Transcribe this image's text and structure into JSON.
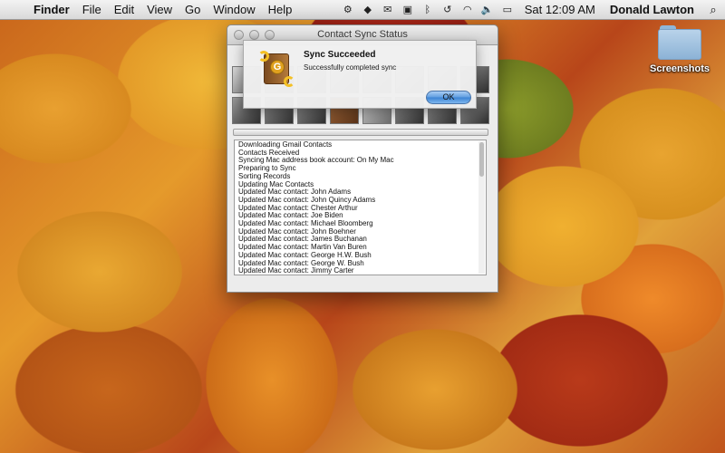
{
  "menubar": {
    "apple_glyph": "",
    "items": [
      {
        "label": "Finder",
        "bold": true
      },
      {
        "label": "File",
        "bold": false
      },
      {
        "label": "Edit",
        "bold": false
      },
      {
        "label": "View",
        "bold": false
      },
      {
        "label": "Go",
        "bold": false
      },
      {
        "label": "Window",
        "bold": false
      },
      {
        "label": "Help",
        "bold": false
      }
    ],
    "clock": "Sat 12:09 AM",
    "username": "Donald Lawton"
  },
  "desktop": {
    "folder_label": "Screenshots"
  },
  "window": {
    "title": "Contact Sync Status",
    "log_lines": [
      "Downloading Gmail Contacts",
      "Contacts Received",
      "Syncing Mac address book account: On My Mac",
      "Preparing to Sync",
      "Sorting Records",
      "Updating Mac Contacts",
      "Updated Mac contact: John Adams",
      "Updated Mac contact: John Quincy Adams",
      "Updated Mac contact: Chester Arthur",
      "Updated Mac contact: Joe Biden",
      "Updated Mac contact: Michael Bloomberg",
      "Updated Mac contact: John Boehner",
      "Updated Mac contact: James Buchanan",
      "Updated Mac contact: Martin Van Buren",
      "Updated Mac contact: George H.W. Bush",
      "Updated Mac contact: George W. Bush",
      "Updated Mac contact: Jimmy Carter"
    ]
  },
  "alert": {
    "heading": "Sync Succeeded",
    "message": "Successfully completed sync",
    "ok_label": "OK"
  }
}
